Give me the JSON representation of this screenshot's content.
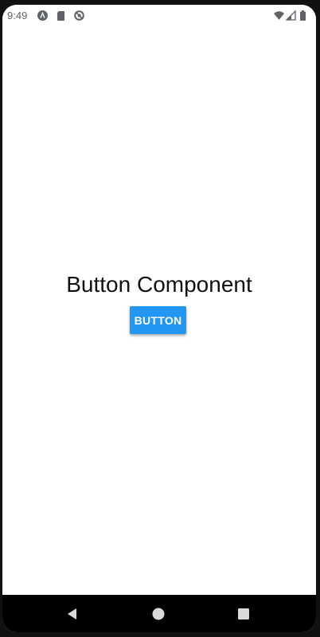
{
  "status_bar": {
    "time": "9:49",
    "left_icons": [
      "app-a-icon",
      "sd-card-icon",
      "no-sync-icon"
    ],
    "right_icons": [
      "wifi-icon",
      "cell-signal-icon",
      "battery-icon"
    ]
  },
  "main": {
    "title": "Button Component",
    "button_label": "BUTTON"
  },
  "nav_bar": {
    "buttons": [
      "back-icon",
      "home-icon",
      "recents-icon"
    ]
  },
  "colors": {
    "button_bg": "#2196f3",
    "button_text": "#ffffff",
    "title_text": "#111111",
    "nav_bg": "#000000"
  }
}
